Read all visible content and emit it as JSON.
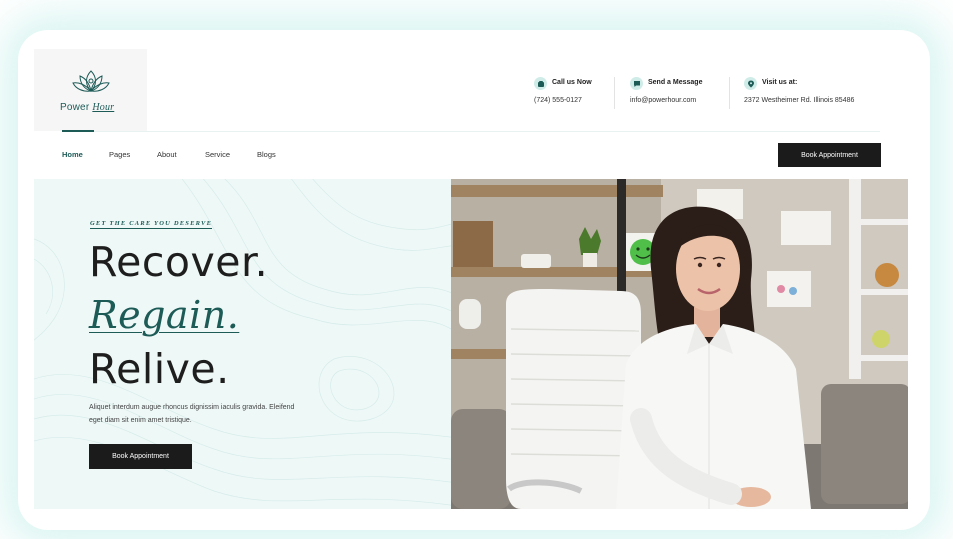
{
  "brand": {
    "name_plain": "Power",
    "name_accent": "Hour"
  },
  "contacts": [
    {
      "title": "Call us Now",
      "value": "(724) 555-0127",
      "icon": "phone-icon"
    },
    {
      "title": "Send a Message",
      "value": "info@powerhour.com",
      "icon": "chat-icon"
    },
    {
      "title": "Visit us at:",
      "value": "2372 Westheimer Rd. Illinois 85486",
      "icon": "location-icon"
    }
  ],
  "nav": {
    "items": [
      "Home",
      "Pages",
      "About",
      "Service",
      "Blogs"
    ],
    "active": "Home",
    "cta_label": "Book Appointment"
  },
  "hero": {
    "eyebrow": "GET THE CARE YOU DESERVE",
    "line1": "Recover.",
    "line2": "Regain.",
    "line3": "Relive.",
    "paragraph": "Aliquet interdum augue rhoncus dignissim iaculis gravida. Eleifend eget diam sit enim amet tristique.",
    "cta_label": "Book Appointment"
  },
  "colors": {
    "accent": "#1d5b57",
    "hero_bg": "#eef8f7",
    "button": "#1b1b1b"
  }
}
